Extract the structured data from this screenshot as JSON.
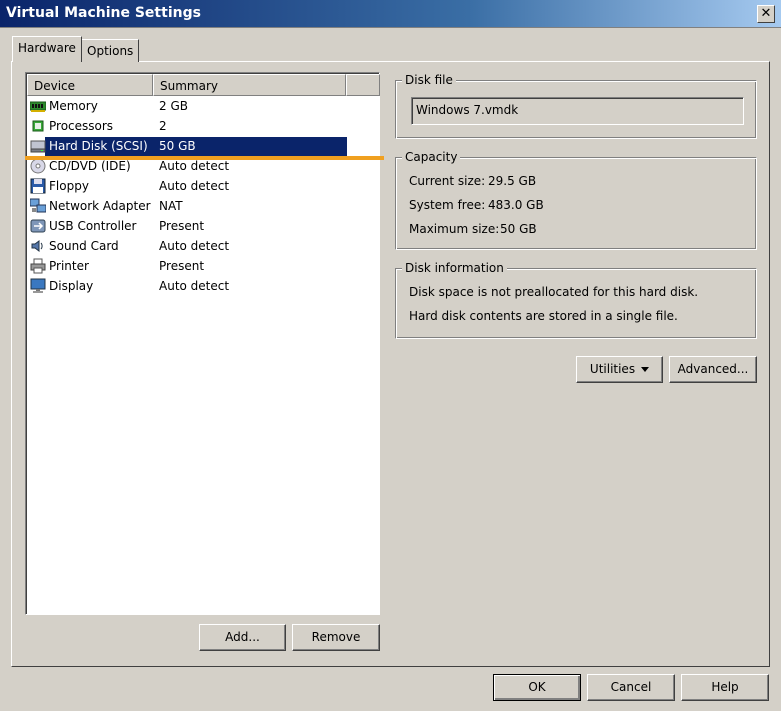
{
  "window": {
    "title": "Virtual Machine Settings",
    "close_label": "✕"
  },
  "tabs": [
    {
      "label": "Hardware",
      "active": true
    },
    {
      "label": "Options",
      "active": false
    }
  ],
  "device_list": {
    "columns": [
      "Device",
      "Summary"
    ],
    "rows": [
      {
        "device": "Memory",
        "summary": "2 GB",
        "icon": "memory-icon"
      },
      {
        "device": "Processors",
        "summary": "2",
        "icon": "processor-icon"
      },
      {
        "device": "Hard Disk (SCSI)",
        "summary": "50 GB",
        "icon": "hard-disk-icon",
        "selected": true
      },
      {
        "device": "CD/DVD (IDE)",
        "summary": "Auto detect",
        "icon": "cd-dvd-icon"
      },
      {
        "device": "Floppy",
        "summary": "Auto detect",
        "icon": "floppy-icon"
      },
      {
        "device": "Network Adapter",
        "summary": "NAT",
        "icon": "network-adapter-icon"
      },
      {
        "device": "USB Controller",
        "summary": "Present",
        "icon": "usb-icon"
      },
      {
        "device": "Sound Card",
        "summary": "Auto detect",
        "icon": "sound-card-icon"
      },
      {
        "device": "Printer",
        "summary": "Present",
        "icon": "printer-icon"
      },
      {
        "device": "Display",
        "summary": "Auto detect",
        "icon": "display-icon"
      }
    ],
    "add_label": "Add...",
    "remove_label": "Remove"
  },
  "disk_file": {
    "title": "Disk file",
    "value": "Windows 7.vmdk"
  },
  "capacity": {
    "title": "Capacity",
    "current_size_label": "Current size:",
    "current_size_value": "29.5 GB",
    "system_free_label": "System free:",
    "system_free_value": "483.0 GB",
    "maximum_size_label": "Maximum size:",
    "maximum_size_value": "50 GB"
  },
  "disk_information": {
    "title": "Disk information",
    "line1": "Disk space is not preallocated for this hard disk.",
    "line2": "Hard disk contents are stored in a single file."
  },
  "actions": {
    "utilities_label": "Utilities",
    "advanced_label": "Advanced..."
  },
  "footer": {
    "ok_label": "OK",
    "cancel_label": "Cancel",
    "help_label": "Help"
  },
  "colors": {
    "selection": "#0a246a",
    "focus_accent": "#f0a020",
    "dialog_bg": "#d4d0c8"
  }
}
